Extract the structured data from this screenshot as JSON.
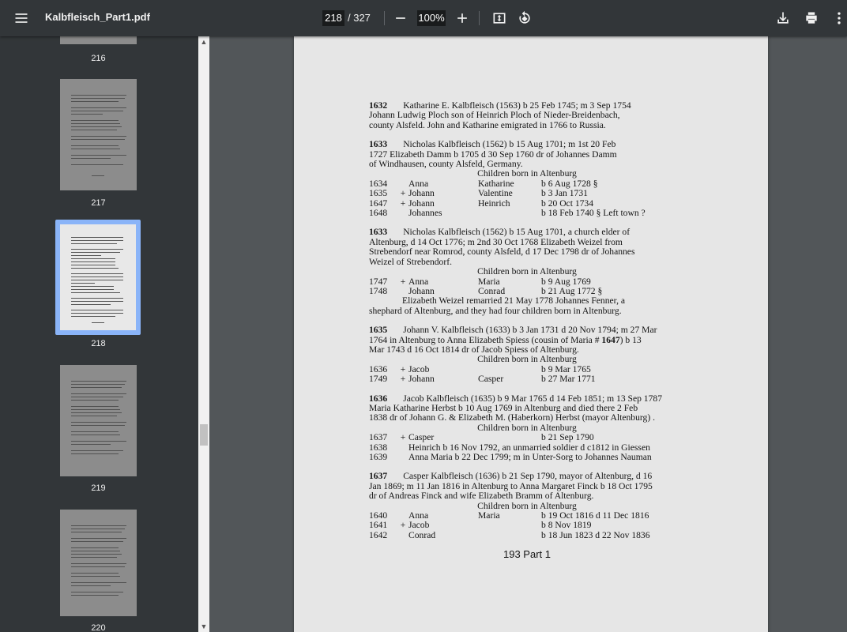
{
  "toolbar": {
    "title": "Kalbfleisch_Part1.pdf",
    "current_page": "218",
    "total_pages": "/ 327",
    "zoom": "100%"
  },
  "thumbnails": [
    {
      "num": "216"
    },
    {
      "num": "217"
    },
    {
      "num": "218"
    },
    {
      "num": "219"
    },
    {
      "num": "220"
    }
  ],
  "document": {
    "e1632": {
      "id": "1632",
      "text": "Katharine E. Kalbfleisch (1563) b 25 Feb 1745; m 3 Sep 1754",
      "lines": [
        "Johann Ludwig Ploch son of Heinrich Ploch of Nieder-Breidenbach,",
        "county Alsfeld. John and Katharine emigrated in 1766 to Russia."
      ]
    },
    "e1633a": {
      "id": "1633",
      "text": "Nicholas Kalbfleisch (1562) b 15 Aug 1701; m 1st 20 Feb",
      "lines": [
        "1727 Elizabeth Damm b 1705 d 30 Sep 1760 dr of Johannes Damm",
        "of Windhausen, county Alsfeld, Germany."
      ],
      "heading": "Children born in Altenburg",
      "children": [
        [
          "1634",
          "",
          "Anna",
          "Katharine",
          "b  6  Aug 1728 §"
        ],
        [
          "1635",
          "+",
          "Johann",
          "Valentine",
          "b  3  Jan 1731"
        ],
        [
          "1647",
          "+",
          "Johann",
          "Heinrich",
          "b 20   Oct 1734"
        ],
        [
          "1648",
          "",
          "Johannes",
          "",
          "b 18   Feb 1740  § Left town ?"
        ]
      ]
    },
    "e1633b": {
      "id": "1633",
      "text": "Nicholas Kalbfleisch (1562) b 15 Aug 1701, a church elder of",
      "lines": [
        "Altenburg, d 14 Oct 1776; m 2nd 30 Oct 1768 Elizabeth Weizel from",
        "Strebendorf near Romrod, county Alsfeld, d 17 Dec 1798 dr of Johannes",
        "Weizel of Strebendorf."
      ],
      "heading": "Children born in Altenburg",
      "children": [
        [
          "1747",
          "+",
          "Anna",
          "Maria",
          "b  9  Aug 1769"
        ],
        [
          "1748",
          "",
          "Johann",
          "Conrad",
          "b 21  Aug 1772 §"
        ]
      ],
      "note1": "Elizabeth Weizel remarried 21 May 1778 Johannes Fenner, a",
      "note2": "shephard of Altenburg, and they had four children born in Altenburg."
    },
    "e1635": {
      "id": "1635",
      "text": "Johann V. Kalbfleisch (1633) b 3 Jan 1731 d 20 Nov 1794;  m 27 Mar",
      "line1": "1764 in Altenburg to Anna Elizabeth Spiess  (cousin of Maria # ",
      "line1_bold": "1647",
      "line1_end": ") b 13",
      "line2": "Mar 1743 d 16 Oct 1814 dr of Jacob Spiess of Altenburg.",
      "heading": "Children born in Altenburg",
      "children": [
        [
          "1636",
          "+",
          "Jacob",
          "",
          "b  9  Mar 1765"
        ],
        [
          "1749",
          "+",
          "Johann",
          "Casper",
          "b 27  Mar 1771"
        ]
      ]
    },
    "e1636": {
      "id": "1636",
      "text": "Jacob Kalbfleisch (1635) b 9 Mar 1765 d 14 Feb 1851; m 13 Sep 1787",
      "lines": [
        "Maria Katharine Herbst b 10 Aug 1769 in Altenburg and died there 2 Feb",
        "1838 dr of Johann G. & Elizabeth M. (Haberkorn) Herbst (mayor Altenburg) ."
      ],
      "heading": "Children born in Altenburg",
      "child1": [
        "1637",
        "+",
        "Casper",
        "",
        "b 21  Sep 1790"
      ],
      "child2": [
        "1638",
        "Heinrich b 16 Nov 1792, an unmarried soldier d c1812 in Giessen"
      ],
      "child3": [
        "1639",
        "Anna Maria b 22 Dec 1799; m in Unter-Sorg to Johannes Nauman"
      ]
    },
    "e1637": {
      "id": "1637",
      "text": "Casper Kalbfleisch (1636) b 21 Sep 1790, mayor of Altenburg, d 16",
      "lines": [
        "Jan 1869; m 11 Jan 1816 in Altenburg to Anna Margaret Finck b 18 Oct 1795",
        "dr of Andreas Finck and wife Elizabeth Bramm of Altenburg."
      ],
      "heading": "Children born in Altenburg",
      "children": [
        [
          "1640",
          "",
          "Anna",
          "Maria",
          "b 19   Oct 1816  d 11 Dec 1816"
        ],
        [
          "1641",
          "+",
          "Jacob",
          "",
          "b  8  Nov 1819"
        ],
        [
          "1642",
          "",
          "Conrad",
          "",
          "b 18  Jun 1823  d   22 Nov 1836"
        ]
      ]
    },
    "footer": "193    Part 1"
  }
}
